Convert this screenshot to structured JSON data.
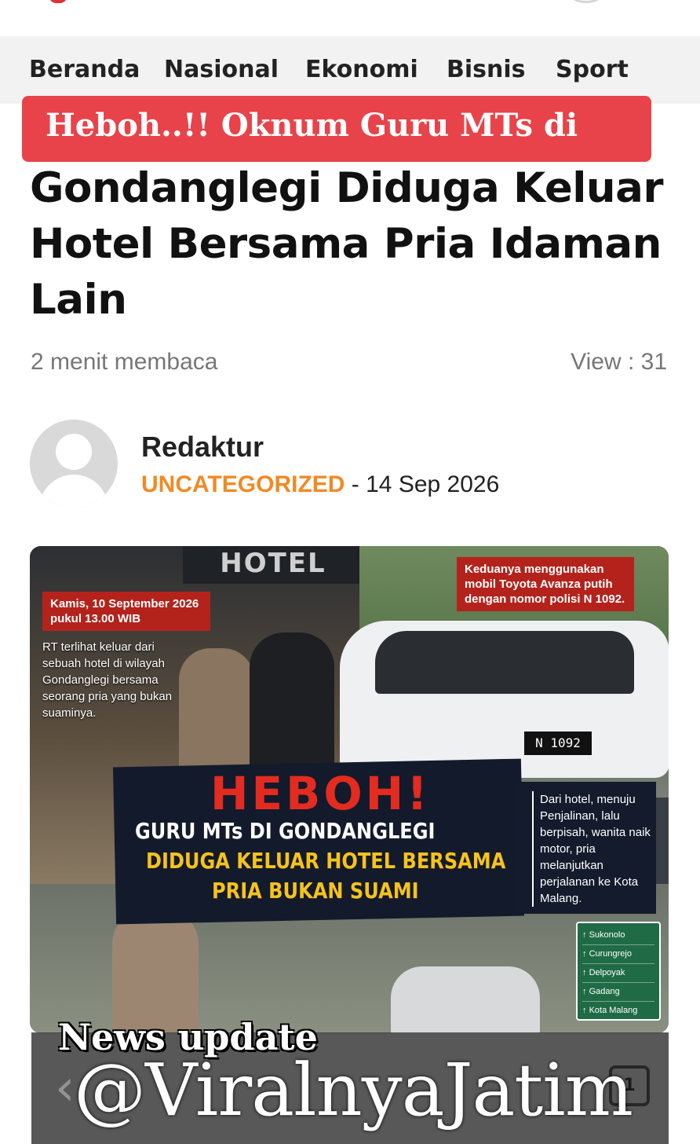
{
  "nav": {
    "items": [
      "Beranda",
      "Nasional",
      "Ekonomi",
      "Bisnis",
      "Sport"
    ]
  },
  "article": {
    "title_highlight": "Heboh..!! Oknum Guru MTs di",
    "title_rest": "Gondanglegi Diduga Keluar Hotel Bersama Pria Idaman Lain",
    "read_time": "2 menit membaca",
    "views": "View : 31",
    "author": "Redaktur",
    "category": "UNCATEGORIZED",
    "date_sep": " - ",
    "date": "14 Sep 2026"
  },
  "image": {
    "hotel_sign": "HOTEL",
    "date_tag": "Kamis, 10 September 2026 pukul 13.00 WIB",
    "left_note": "RT terlihat keluar dari sebuah hotel di wilayah Gondanglegi bersama seorang pria yang bukan suaminya.",
    "car_tag": "Keduanya menggunakan mobil Toyota Avanza putih dengan nomor polisi N 1092.",
    "plate": "N 1092",
    "headline_big": "HEBOH!",
    "headline_line1": "GURU MTs DI GONDANGLEGI",
    "headline_line2": "DIDUGA KELUAR HOTEL BERSAMA",
    "headline_line3": "PRIA BUKAN SUAMI",
    "route_note": "Dari hotel, menuju Penjalinan, lalu berpisah, wanita naik motor, pria melanjutkan perjalanan ke Kota Malang.",
    "signs": [
      "Sukonolo",
      "Curungrejo",
      "Delpoyak",
      "Gadang",
      "Kota Malang"
    ]
  },
  "watermark": {
    "label": "News update",
    "handle": "@ViralnyaJatim"
  },
  "browser": {
    "tab_count": "1"
  },
  "colors": {
    "title_bg": "#e8434a",
    "category": "#f08a24"
  }
}
